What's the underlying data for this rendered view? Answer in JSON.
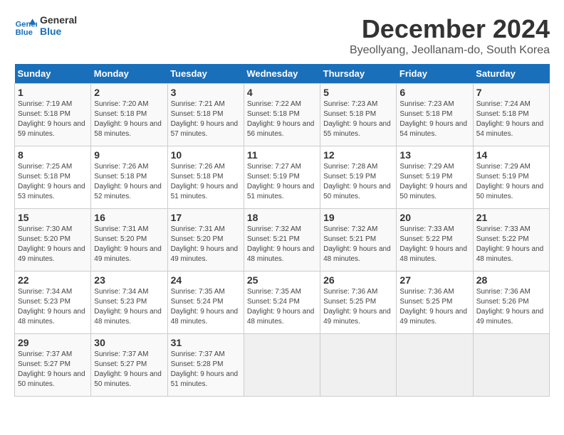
{
  "header": {
    "logo_line1": "General",
    "logo_line2": "Blue",
    "title": "December 2024",
    "location": "Byeollyang, Jeollanam-do, South Korea"
  },
  "days_of_week": [
    "Sunday",
    "Monday",
    "Tuesday",
    "Wednesday",
    "Thursday",
    "Friday",
    "Saturday"
  ],
  "weeks": [
    [
      {
        "day": "1",
        "sunrise": "7:19 AM",
        "sunset": "5:18 PM",
        "daylight": "9 hours and 59 minutes."
      },
      {
        "day": "2",
        "sunrise": "7:20 AM",
        "sunset": "5:18 PM",
        "daylight": "9 hours and 58 minutes."
      },
      {
        "day": "3",
        "sunrise": "7:21 AM",
        "sunset": "5:18 PM",
        "daylight": "9 hours and 57 minutes."
      },
      {
        "day": "4",
        "sunrise": "7:22 AM",
        "sunset": "5:18 PM",
        "daylight": "9 hours and 56 minutes."
      },
      {
        "day": "5",
        "sunrise": "7:23 AM",
        "sunset": "5:18 PM",
        "daylight": "9 hours and 55 minutes."
      },
      {
        "day": "6",
        "sunrise": "7:23 AM",
        "sunset": "5:18 PM",
        "daylight": "9 hours and 54 minutes."
      },
      {
        "day": "7",
        "sunrise": "7:24 AM",
        "sunset": "5:18 PM",
        "daylight": "9 hours and 54 minutes."
      }
    ],
    [
      {
        "day": "8",
        "sunrise": "7:25 AM",
        "sunset": "5:18 PM",
        "daylight": "9 hours and 53 minutes."
      },
      {
        "day": "9",
        "sunrise": "7:26 AM",
        "sunset": "5:18 PM",
        "daylight": "9 hours and 52 minutes."
      },
      {
        "day": "10",
        "sunrise": "7:26 AM",
        "sunset": "5:18 PM",
        "daylight": "9 hours and 51 minutes."
      },
      {
        "day": "11",
        "sunrise": "7:27 AM",
        "sunset": "5:19 PM",
        "daylight": "9 hours and 51 minutes."
      },
      {
        "day": "12",
        "sunrise": "7:28 AM",
        "sunset": "5:19 PM",
        "daylight": "9 hours and 50 minutes."
      },
      {
        "day": "13",
        "sunrise": "7:29 AM",
        "sunset": "5:19 PM",
        "daylight": "9 hours and 50 minutes."
      },
      {
        "day": "14",
        "sunrise": "7:29 AM",
        "sunset": "5:19 PM",
        "daylight": "9 hours and 50 minutes."
      }
    ],
    [
      {
        "day": "15",
        "sunrise": "7:30 AM",
        "sunset": "5:20 PM",
        "daylight": "9 hours and 49 minutes."
      },
      {
        "day": "16",
        "sunrise": "7:31 AM",
        "sunset": "5:20 PM",
        "daylight": "9 hours and 49 minutes."
      },
      {
        "day": "17",
        "sunrise": "7:31 AM",
        "sunset": "5:20 PM",
        "daylight": "9 hours and 49 minutes."
      },
      {
        "day": "18",
        "sunrise": "7:32 AM",
        "sunset": "5:21 PM",
        "daylight": "9 hours and 48 minutes."
      },
      {
        "day": "19",
        "sunrise": "7:32 AM",
        "sunset": "5:21 PM",
        "daylight": "9 hours and 48 minutes."
      },
      {
        "day": "20",
        "sunrise": "7:33 AM",
        "sunset": "5:22 PM",
        "daylight": "9 hours and 48 minutes."
      },
      {
        "day": "21",
        "sunrise": "7:33 AM",
        "sunset": "5:22 PM",
        "daylight": "9 hours and 48 minutes."
      }
    ],
    [
      {
        "day": "22",
        "sunrise": "7:34 AM",
        "sunset": "5:23 PM",
        "daylight": "9 hours and 48 minutes."
      },
      {
        "day": "23",
        "sunrise": "7:34 AM",
        "sunset": "5:23 PM",
        "daylight": "9 hours and 48 minutes."
      },
      {
        "day": "24",
        "sunrise": "7:35 AM",
        "sunset": "5:24 PM",
        "daylight": "9 hours and 48 minutes."
      },
      {
        "day": "25",
        "sunrise": "7:35 AM",
        "sunset": "5:24 PM",
        "daylight": "9 hours and 48 minutes."
      },
      {
        "day": "26",
        "sunrise": "7:36 AM",
        "sunset": "5:25 PM",
        "daylight": "9 hours and 49 minutes."
      },
      {
        "day": "27",
        "sunrise": "7:36 AM",
        "sunset": "5:25 PM",
        "daylight": "9 hours and 49 minutes."
      },
      {
        "day": "28",
        "sunrise": "7:36 AM",
        "sunset": "5:26 PM",
        "daylight": "9 hours and 49 minutes."
      }
    ],
    [
      {
        "day": "29",
        "sunrise": "7:37 AM",
        "sunset": "5:27 PM",
        "daylight": "9 hours and 50 minutes."
      },
      {
        "day": "30",
        "sunrise": "7:37 AM",
        "sunset": "5:27 PM",
        "daylight": "9 hours and 50 minutes."
      },
      {
        "day": "31",
        "sunrise": "7:37 AM",
        "sunset": "5:28 PM",
        "daylight": "9 hours and 51 minutes."
      },
      null,
      null,
      null,
      null
    ]
  ]
}
